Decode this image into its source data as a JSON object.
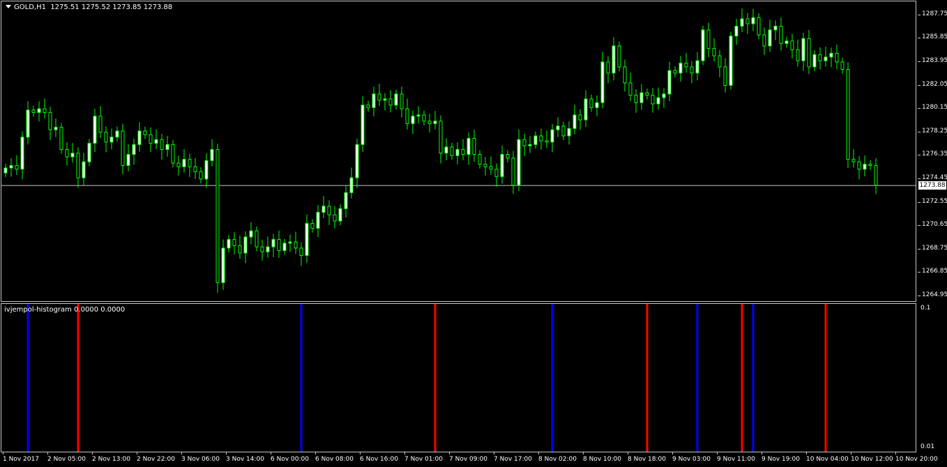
{
  "window": {
    "symbol_title": "GOLD,H1",
    "ohlc_text": "1275.51 1275.52 1273.85 1273.88"
  },
  "price_axis": {
    "ticks": [
      "1287.75",
      "1285.85",
      "1283.95",
      "1282.05",
      "1280.15",
      "1278.25",
      "1276.35",
      "1274.45",
      "1272.55",
      "1270.65",
      "1268.75",
      "1266.85",
      "1264.95"
    ],
    "current_price": "1273.88"
  },
  "indicator": {
    "title": "ivjempol-histogram 0.0000 0.0000",
    "axis_ticks": [
      "0.1",
      "0.01"
    ],
    "signals": [
      {
        "bar": 4,
        "color": "#0000ff"
      },
      {
        "bar": 13,
        "color": "#ff0000"
      },
      {
        "bar": 53,
        "color": "#0000ff"
      },
      {
        "bar": 77,
        "color": "#ff0000"
      },
      {
        "bar": 98,
        "color": "#0000ff"
      },
      {
        "bar": 115,
        "color": "#ff0000"
      },
      {
        "bar": 124,
        "color": "#0000ff"
      },
      {
        "bar": 132,
        "color": "#ff0000"
      },
      {
        "bar": 134,
        "color": "#0000ff"
      },
      {
        "bar": 147,
        "color": "#ff0000"
      }
    ]
  },
  "time_axis": {
    "labels": [
      "1 Nov 2017",
      "2 Nov 05:00",
      "2 Nov 13:00",
      "2 Nov 22:00",
      "3 Nov 06:00",
      "3 Nov 14:00",
      "6 Nov 00:00",
      "6 Nov 08:00",
      "6 Nov 16:00",
      "7 Nov 01:00",
      "7 Nov 09:00",
      "7 Nov 17:00",
      "8 Nov 02:00",
      "8 Nov 10:00",
      "8 Nov 18:00",
      "9 Nov 03:00",
      "9 Nov 11:00",
      "9 Nov 19:00",
      "10 Nov 04:00",
      "10 Nov 12:00",
      "10 Nov 20:00"
    ]
  },
  "colors": {
    "background": "#000000",
    "bull_candle": "#ffffff",
    "bear_candle": "#000000",
    "wick": "#00ff00",
    "current_price_line": "#c8c8c8"
  },
  "chart_data": {
    "type": "candlestick",
    "y_range": [
      1264.95,
      1288.7
    ],
    "current_price": 1273.88,
    "close_series": [
      1275.3,
      1275.5,
      1275.2,
      1277.8,
      1280.0,
      1279.8,
      1280.1,
      1279.8,
      1278.4,
      1278.6,
      1276.8,
      1276.2,
      1276.5,
      1274.5,
      1275.8,
      1277.3,
      1279.5,
      1278.2,
      1277.4,
      1277.8,
      1278.3,
      1275.5,
      1276.4,
      1277.2,
      1278.3,
      1278.0,
      1277.3,
      1277.6,
      1276.8,
      1277.2,
      1275.7,
      1275.4,
      1276.0,
      1275.4,
      1275.0,
      1274.4,
      1275.9,
      1276.8,
      1266.0,
      1268.8,
      1269.5,
      1269.0,
      1268.4,
      1269.7,
      1270.2,
      1268.9,
      1268.5,
      1268.9,
      1269.5,
      1268.6,
      1269.2,
      1269.3,
      1268.8,
      1268.2,
      1270.8,
      1270.4,
      1271.7,
      1272.2,
      1271.5,
      1271.0,
      1272.0,
      1273.3,
      1274.5,
      1277.2,
      1280.4,
      1280.2,
      1281.3,
      1280.8,
      1280.9,
      1280.4,
      1281.3,
      1280.1,
      1278.9,
      1279.5,
      1279.6,
      1279.1,
      1278.9,
      1279.1,
      1276.5,
      1277.0,
      1276.3,
      1276.8,
      1276.4,
      1277.7,
      1276.4,
      1275.6,
      1275.4,
      1275.2,
      1274.6,
      1276.4,
      1276.1,
      1273.9,
      1277.6,
      1277.1,
      1277.2,
      1277.9,
      1277.5,
      1277.4,
      1278.4,
      1278.7,
      1277.9,
      1278.5,
      1279.6,
      1279.2,
      1280.9,
      1280.2,
      1280.6,
      1283.9,
      1283.0,
      1285.2,
      1283.5,
      1282.2,
      1281.2,
      1280.6,
      1281.4,
      1281.2,
      1280.5,
      1281.0,
      1281.3,
      1283.2,
      1283.0,
      1283.8,
      1283.5,
      1283.0,
      1284.0,
      1286.5,
      1285.0,
      1284.4,
      1283.5,
      1282.0,
      1286.0,
      1286.8,
      1287.4,
      1287.0,
      1287.5,
      1286.1,
      1285.2,
      1286.5,
      1286.8,
      1285.4,
      1285.6,
      1284.9,
      1284.0,
      1285.8,
      1283.5,
      1284.5,
      1284.0,
      1284.3,
      1284.6,
      1283.9,
      1283.3,
      1276.0,
      1275.8,
      1275.2,
      1275.6,
      1275.5,
      1273.9
    ],
    "x_labels": [
      "1 Nov 2017",
      "2 Nov 05:00",
      "2 Nov 13:00",
      "2 Nov 22:00",
      "3 Nov 06:00",
      "3 Nov 14:00",
      "6 Nov 00:00",
      "6 Nov 08:00",
      "6 Nov 16:00",
      "7 Nov 01:00",
      "7 Nov 09:00",
      "7 Nov 17:00",
      "8 Nov 02:00",
      "8 Nov 10:00",
      "8 Nov 18:00",
      "9 Nov 03:00",
      "9 Nov 11:00",
      "9 Nov 19:00",
      "10 Nov 04:00",
      "10 Nov 12:00",
      "10 Nov 20:00"
    ]
  }
}
